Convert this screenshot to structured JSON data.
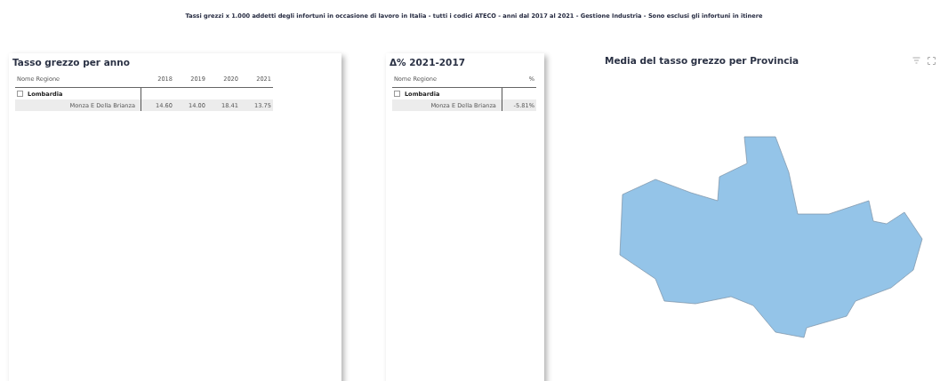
{
  "header": {
    "title": "Tassi grezzi x 1.000 addetti degli infortuni in occasione di lavoro in Italia - tutti i codici ATECO  - anni dal 2017 al 2021 - Gestione Industria - Sono esclusi gli infortuni in itinere"
  },
  "year_table": {
    "title": "Tasso grezzo per anno",
    "columns": [
      "Nome Regione",
      "2018",
      "2019",
      "2020",
      "2021"
    ],
    "groups": [
      {
        "label": "Lombardia",
        "expanded": true,
        "rows": [
          {
            "cells": [
              "Monza E Della Brianza",
              "14.60",
              "14.00",
              "18.41",
              "13.75"
            ]
          }
        ]
      }
    ]
  },
  "delta_table": {
    "title": "Δ% 2021-2017",
    "columns": [
      "Nome Regione",
      "%"
    ],
    "groups": [
      {
        "label": "Lombardia",
        "expanded": true,
        "rows": [
          {
            "cells": [
              "Monza E Della Brianza",
              "-5.81%"
            ]
          }
        ]
      }
    ]
  },
  "map": {
    "title": "Media del tasso grezzo per Provincia"
  }
}
